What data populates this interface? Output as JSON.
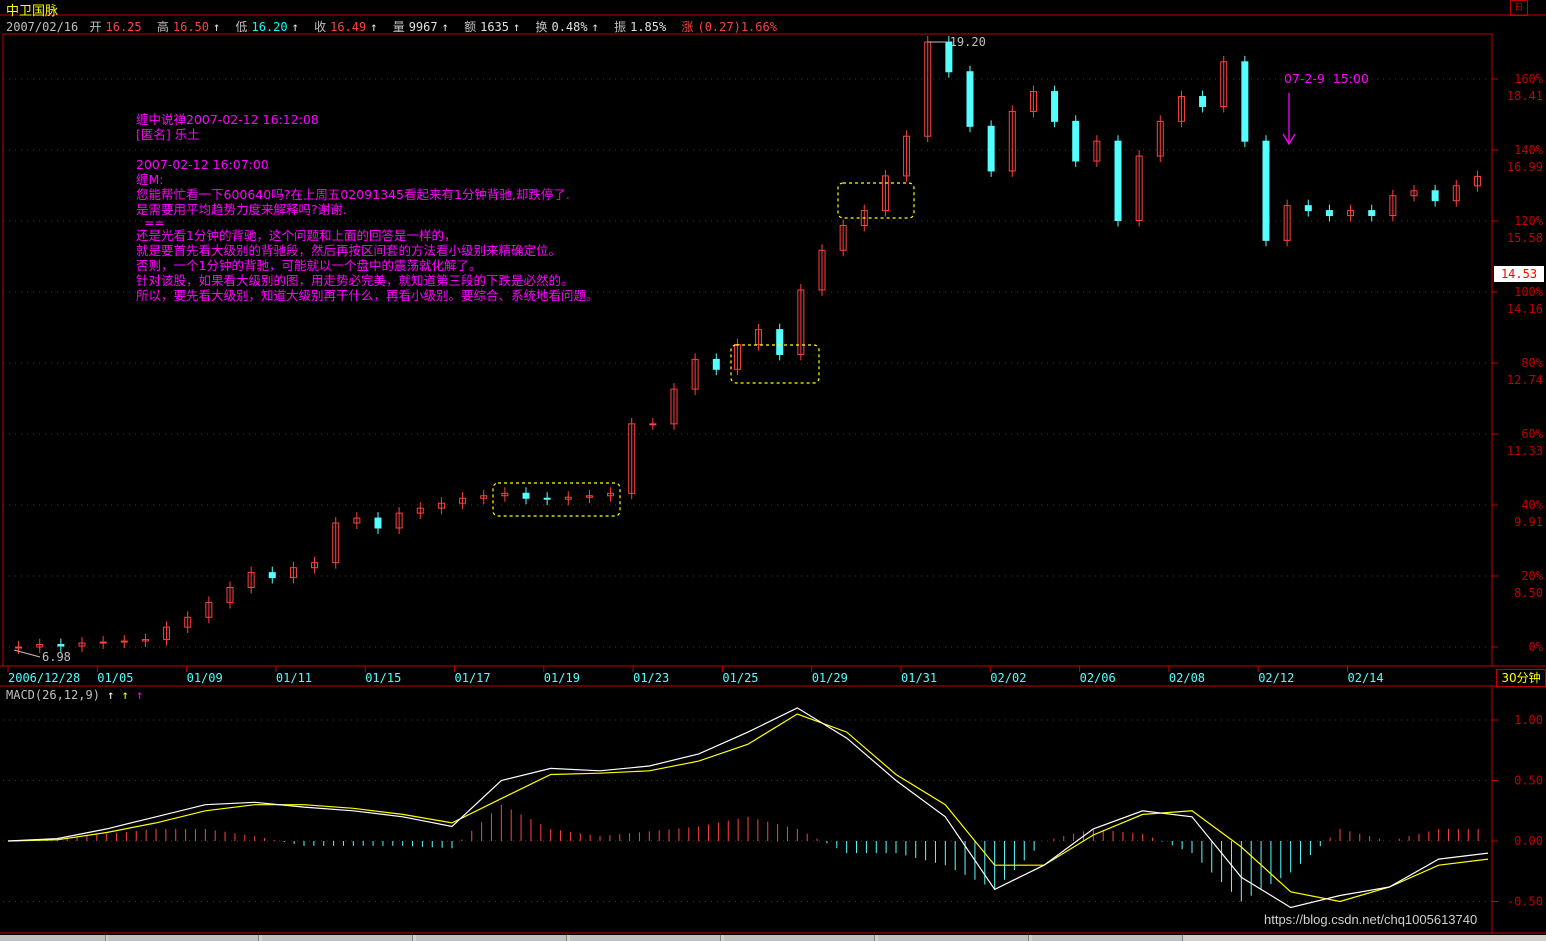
{
  "window": {
    "title": "中卫国脉",
    "restore_glyph": "日"
  },
  "quote_bar": {
    "date": "2007/02/16",
    "open_label": "开",
    "open": "16.25",
    "high_label": "高",
    "high": "16.50",
    "low_label": "低",
    "low": "16.20",
    "close_label": "收",
    "close": "16.49",
    "volume_label": "量",
    "volume": "9967",
    "amount_label": "额",
    "amount": "1635",
    "turnover_label": "换",
    "turnover": "0.48%",
    "amplitude_label": "振",
    "amplitude": "1.85%",
    "change_label": "涨",
    "change": "(0.27)1.66%"
  },
  "annotation": {
    "lines": [
      "缠中说禅2007-02-12 16:12:08",
      "[匿名] 乐土",
      "",
      "2007-02-12 16:07:00",
      "缠M:",
      "您能帮忙看一下600640吗?在上周五02091345看起来有1分钟背驰,却跌停了.",
      "是需要用平均趋势力度来解释吗?谢谢.",
      "  ==",
      "还是光看1分钟的背驰，这个问题和上面的回答是一样的，",
      "就是要首先看大级别的背驰段，然后再按区间套的方法看小级别来精确定位。",
      "否则，一个1分钟的背驰，可能就以一个盘中的震荡就化解了。",
      "针对该股，如果看大级别的图，用走势必完美，就知道第三段的下跌是必然的。",
      "所以，要先看大级别，知道大级别再干什么，再看小级别。要综合、系统地看问题。"
    ]
  },
  "marker": {
    "text": "07-2-9  15:00"
  },
  "price_labels": {
    "max": "19.20",
    "min": "6.98"
  },
  "right_axis": [
    {
      "pct": "160%",
      "price": "18.41"
    },
    {
      "pct": "140%",
      "price": "16.99"
    },
    {
      "pct": "120%",
      "price": "15.58"
    },
    {
      "pct": "100%",
      "price": "14.16"
    },
    {
      "pct": "80%",
      "price": "12.74"
    },
    {
      "pct": "60%",
      "price": "11.33"
    },
    {
      "pct": "40%",
      "price": "9.91"
    },
    {
      "pct": "20%",
      "price": "8.50"
    },
    {
      "pct": "0%",
      "price": ""
    }
  ],
  "current_price": "14.53",
  "date_axis": [
    "2006/12/28",
    "01/05",
    "01/09",
    "01/11",
    "01/15",
    "01/17",
    "01/19",
    "01/23",
    "01/25",
    "01/29",
    "01/31",
    "02/02",
    "02/06",
    "02/08",
    "02/12",
    "02/14"
  ],
  "period": "30分钟",
  "macd": {
    "title": "MACD(26,12,9)",
    "arrows": [
      "↑",
      "↑",
      "↑"
    ],
    "axis": [
      "1.00",
      "0.50",
      "0.00",
      "-0.50"
    ]
  },
  "watermark": "https://blog.csdn.net/chq1005613740",
  "colors": {
    "up": "#ff4040",
    "down": "#54ffff",
    "dif": "#ffffff",
    "dea": "#ffff00",
    "note": "#ff00ff",
    "grid": "#c00000"
  },
  "chart_data": {
    "type": "candlestick",
    "title": "中卫国脉",
    "price_min": 6.98,
    "price_max": 19.2,
    "closes": [
      7.0,
      7.05,
      7.02,
      7.08,
      7.1,
      7.12,
      7.15,
      7.4,
      7.6,
      7.9,
      8.2,
      8.5,
      8.4,
      8.6,
      8.7,
      9.5,
      9.6,
      9.4,
      9.7,
      9.8,
      9.9,
      10.0,
      10.05,
      10.1,
      10.0,
      9.98,
      10.02,
      10.05,
      10.1,
      11.5,
      11.5,
      12.2,
      12.8,
      12.6,
      13.1,
      13.4,
      12.9,
      14.2,
      15.0,
      15.5,
      15.8,
      16.5,
      17.3,
      19.2,
      18.6,
      17.5,
      16.6,
      17.8,
      18.2,
      17.6,
      16.8,
      17.2,
      15.6,
      16.9,
      17.6,
      18.1,
      17.9,
      18.8,
      17.2,
      15.2,
      15.9,
      15.8,
      15.7,
      15.8,
      15.7,
      16.1,
      16.2,
      16.0,
      16.3,
      16.49
    ],
    "macd": {
      "dif": [
        0.0,
        0.02,
        0.1,
        0.2,
        0.3,
        0.32,
        0.28,
        0.25,
        0.2,
        0.12,
        0.5,
        0.6,
        0.58,
        0.62,
        0.72,
        0.9,
        1.1,
        0.85,
        0.5,
        0.2,
        -0.4,
        -0.2,
        0.1,
        0.25,
        0.2,
        -0.3,
        -0.55,
        -0.45,
        -0.38,
        -0.15,
        -0.1
      ],
      "dea": [
        0.0,
        0.01,
        0.07,
        0.15,
        0.25,
        0.3,
        0.3,
        0.27,
        0.22,
        0.15,
        0.35,
        0.55,
        0.56,
        0.58,
        0.66,
        0.8,
        1.05,
        0.9,
        0.55,
        0.3,
        -0.2,
        -0.2,
        0.05,
        0.22,
        0.25,
        -0.05,
        -0.42,
        -0.5,
        -0.38,
        -0.2,
        -0.15
      ]
    }
  }
}
